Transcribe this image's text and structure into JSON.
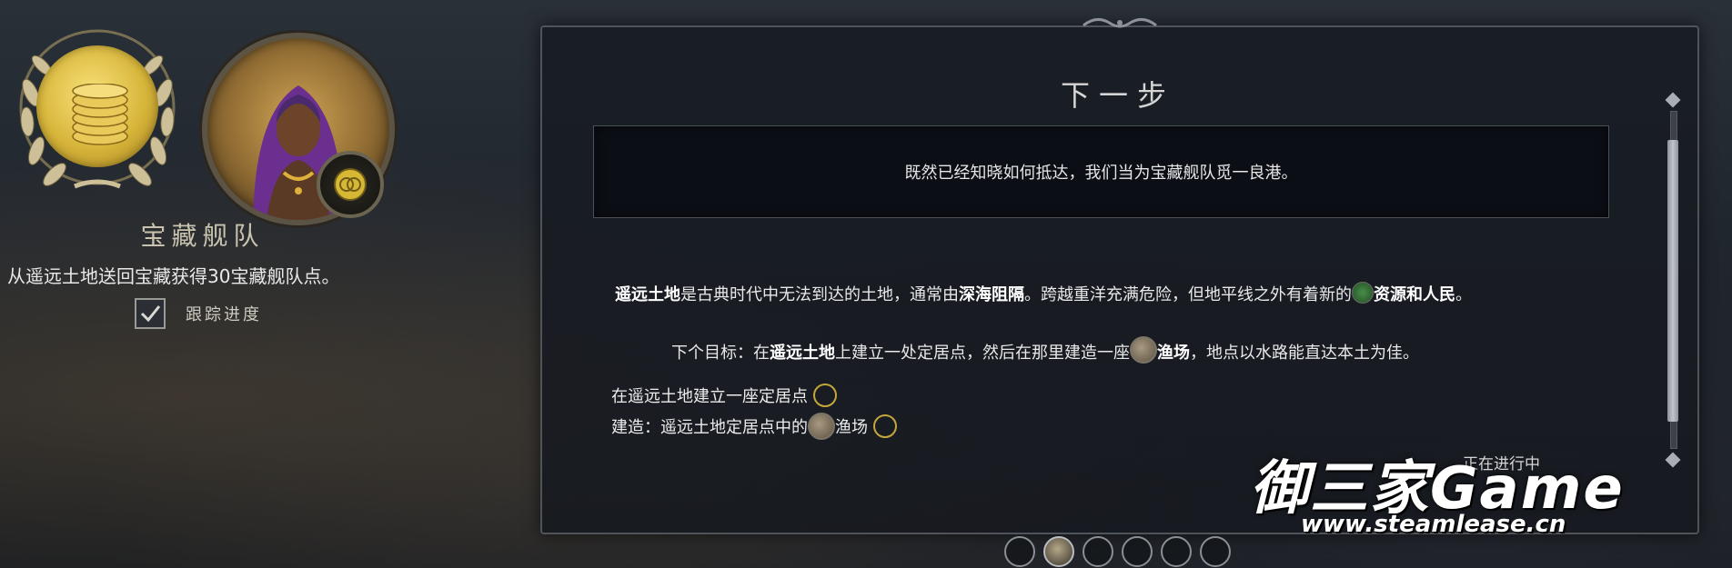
{
  "left": {
    "title": "宝藏舰队",
    "description": "从遥远土地送回宝藏获得30宝藏舰队点。",
    "track_label": "跟踪进度",
    "track_checked": true,
    "icons": {
      "medal": "gold-coin-laurel-icon",
      "portrait": "leader-portrait",
      "badge": "coin-badge-icon"
    }
  },
  "panel": {
    "title": "下一步",
    "quote": "既然已经知晓如何抵达，我们当为宝藏舰队觅一良港。",
    "body": {
      "t1_bold": "遥远土地",
      "t2": "是古典时代中无法到达的土地，通常由",
      "t3_bold": "深海阻隔",
      "t4": "。跨越重洋充满危险，但地平线之外有着新的",
      "t5_bold": "资源和人民",
      "t6": "。"
    },
    "goal": {
      "prefix": "下个目标：在",
      "bold1": "遥远土地",
      "mid": "上建立一处定居点，然后在那里建造一座",
      "bold2": "渔场",
      "suffix": "，地点以水路能直达本土为佳。"
    },
    "objectives": [
      {
        "text_a": "在遥远土地建立一座定居点",
        "text_b": ""
      },
      {
        "text_a": "建造：遥远土地定居点中的",
        "text_b": "渔场"
      }
    ],
    "status": "正在进行中"
  },
  "pager": {
    "count": 6,
    "active_index": 1
  },
  "watermark": {
    "main": "御三家Game",
    "url": "www.steamlease.cn"
  },
  "colors": {
    "gold": "#c4a73a",
    "panel_bg": "#181c24",
    "accent_text": "#e8e8e8"
  }
}
